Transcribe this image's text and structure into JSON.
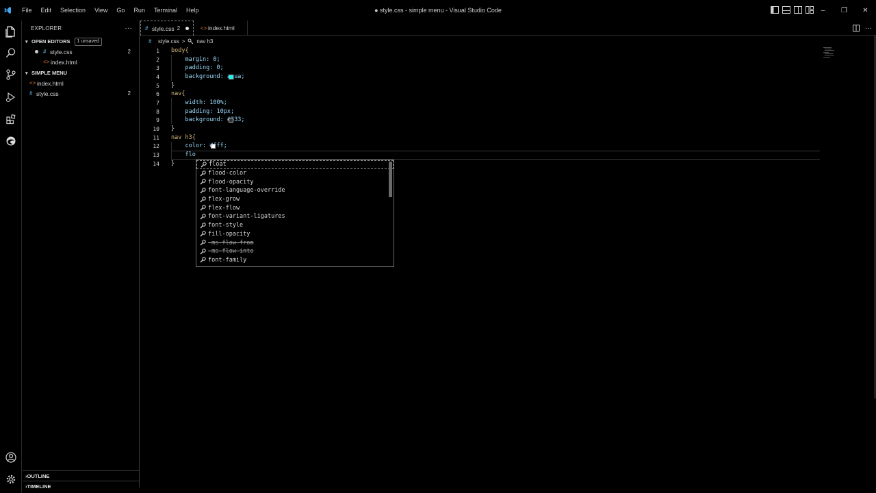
{
  "titlebar": {
    "menu": [
      "File",
      "Edit",
      "Selection",
      "View",
      "Go",
      "Run",
      "Terminal",
      "Help"
    ],
    "title": "● style.css - simple menu - Visual Studio Code",
    "controls": [
      "–",
      "❐",
      "✕"
    ]
  },
  "activity": {
    "icons": [
      "explorer-icon",
      "search-icon",
      "source-control-icon",
      "run-debug-icon",
      "extensions-icon",
      "edge-icon",
      "account-icon",
      "settings-gear-icon"
    ]
  },
  "sidebar": {
    "header": "EXPLORER",
    "more": "···",
    "open_editors": {
      "title": "OPEN EDITORS",
      "badge": "1 unsaved",
      "items": [
        {
          "name": "style.css",
          "count": "2",
          "type": "css",
          "dirty": true
        },
        {
          "name": "index.html",
          "count": "",
          "type": "html",
          "dirty": false
        }
      ]
    },
    "folder": {
      "title": "SIMPLE MENU",
      "items": [
        {
          "name": "index.html",
          "count": "",
          "type": "html"
        },
        {
          "name": "style.css",
          "count": "2",
          "type": "css"
        }
      ]
    },
    "outline": "OUTLINE",
    "timeline": "TIMELINE"
  },
  "tabs": [
    {
      "label": "style.css",
      "badge": "2",
      "active": true,
      "type": "css"
    },
    {
      "label": "index.html",
      "badge": "",
      "active": false,
      "type": "html"
    }
  ],
  "breadcrumb": {
    "file": "style.css",
    "sep": ">",
    "symbol": "nav h3"
  },
  "editor": {
    "lines": [
      {
        "n": "1",
        "text": "body{"
      },
      {
        "n": "2",
        "text": "    margin: 0;"
      },
      {
        "n": "3",
        "text": "    padding: 0;"
      },
      {
        "n": "4",
        "text": "    background: aqua;"
      },
      {
        "n": "5",
        "text": "}"
      },
      {
        "n": "6",
        "text": "nav{"
      },
      {
        "n": "7",
        "text": "    width: 100%;"
      },
      {
        "n": "8",
        "text": "    padding: 10px;"
      },
      {
        "n": "9",
        "text": "    background: #333;"
      },
      {
        "n": "10",
        "text": "}"
      },
      {
        "n": "11",
        "text": "nav h3{"
      },
      {
        "n": "12",
        "text": "    color: #fff;"
      },
      {
        "n": "13",
        "text": "    flo"
      },
      {
        "n": "14",
        "text": "}"
      }
    ],
    "swatch_colors": {
      "aqua": "#00ffff",
      "333": "#333333",
      "fff": "#ffffff"
    }
  },
  "suggestions": [
    {
      "label": "float",
      "deprecated": false
    },
    {
      "label": "flood-color",
      "deprecated": false
    },
    {
      "label": "flood-opacity",
      "deprecated": false
    },
    {
      "label": "font-language-override",
      "deprecated": false
    },
    {
      "label": "flex-grow",
      "deprecated": false
    },
    {
      "label": "flex-flow",
      "deprecated": false
    },
    {
      "label": "font-variant-ligatures",
      "deprecated": false
    },
    {
      "label": "font-style",
      "deprecated": false
    },
    {
      "label": "fill-opacity",
      "deprecated": false
    },
    {
      "label": "-ms-flow-from",
      "deprecated": true
    },
    {
      "label": "-ms-flow-into",
      "deprecated": true
    },
    {
      "label": "font-family",
      "deprecated": false
    }
  ],
  "colors": {
    "accent": "#007acc",
    "css_icon": "#519aba",
    "html_icon": "#e37933"
  }
}
